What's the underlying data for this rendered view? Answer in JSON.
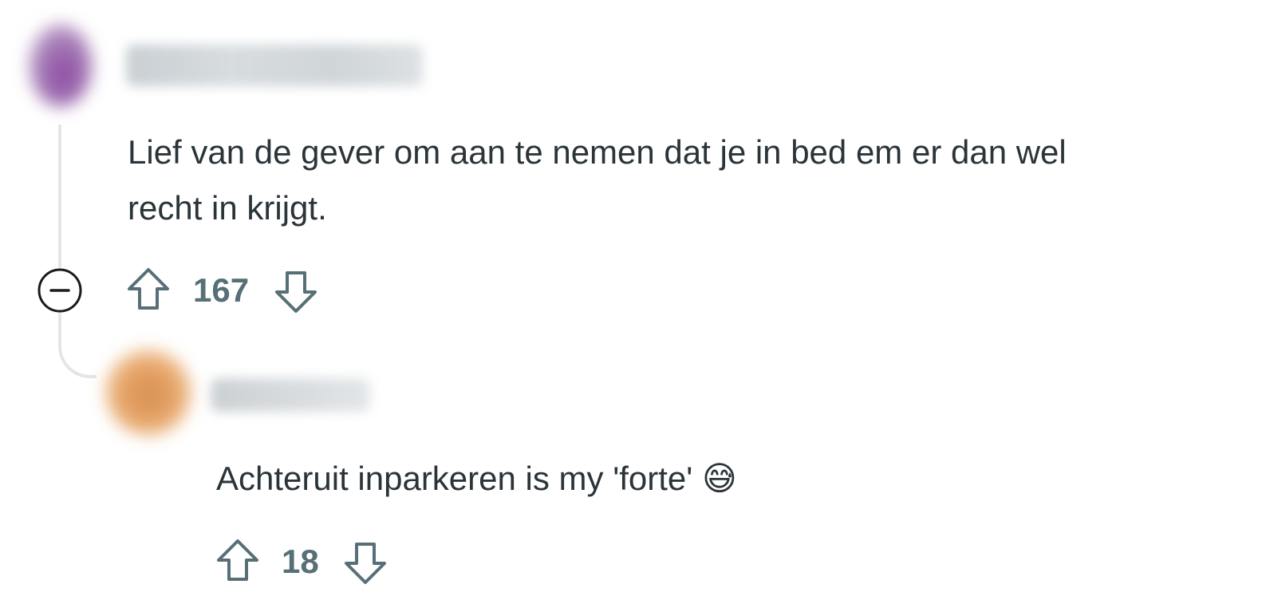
{
  "comments": [
    {
      "body_line1": "Lief van de gever om aan te nemen dat je in bed em er dan wel",
      "body_line2": "recht in krijgt.",
      "score": "167",
      "avatar_color": "#8d4aa4"
    },
    {
      "body": "Achteruit inparkeren is my 'forte'",
      "emoji": "😅",
      "score": "18",
      "avatar_color": "#d58d4f"
    }
  ],
  "icons": {
    "collapse": "minus-circle-icon",
    "upvote": "arrow-up-outline-icon",
    "downvote": "arrow-down-outline-icon"
  },
  "colors": {
    "text": "#2a3439",
    "meta": "#576f76",
    "thread_line": "#e2e6e8"
  }
}
